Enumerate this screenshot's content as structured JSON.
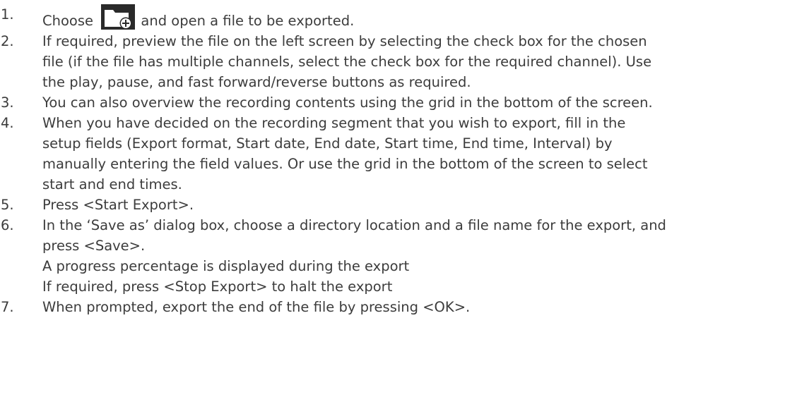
{
  "steps": [
    {
      "number": "1.",
      "before_icon": "Choose",
      "icon": "folder-add-icon",
      "after_icon": "and open a file to be exported."
    },
    {
      "number": "2.",
      "lines": [
        "If required, preview the file on the left screen by selecting the check box for the chosen",
        "file (if the file has multiple channels, select the check box for the required channel). Use",
        "the play, pause, and fast forward/reverse buttons as required."
      ]
    },
    {
      "number": "3.",
      "lines": [
        "You can also overview the recording contents using the grid in the bottom of the screen."
      ]
    },
    {
      "number": "4.",
      "lines": [
        "When you have decided on the recording segment that you wish to export, fill in the",
        "setup fields (Export format, Start date, End date, Start time, End time, Interval) by",
        "manually entering the field values. Or use the grid in the bottom of the screen to select",
        "start and end times."
      ]
    },
    {
      "number": "5.",
      "lines": [
        "Press <Start Export>."
      ]
    },
    {
      "number": "6.",
      "lines": [
        "In the ‘Save as’ dialog box, choose a directory location and a file name for the export, and",
        "press <Save>."
      ],
      "notes": [
        "A progress percentage is displayed during the export",
        "If required, press <Stop Export> to halt the export"
      ]
    },
    {
      "number": "7.",
      "lines": [
        "When prompted, export the end of the file by pressing <OK>."
      ]
    }
  ],
  "colors": {
    "text": "#3c3c3c",
    "icon_dark": "#1f1f1f",
    "icon_light": "#ffffff"
  }
}
